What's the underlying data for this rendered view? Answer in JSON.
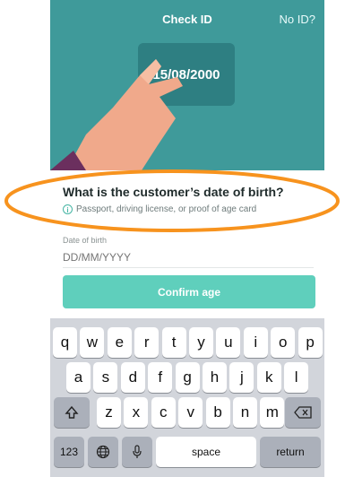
{
  "header": {
    "title": "Check ID",
    "no_id_link": "No ID?"
  },
  "card": {
    "date": "15/08/2000"
  },
  "form": {
    "question": "What is the customer’s date of birth?",
    "hint": "Passport, driving license, or proof of age card",
    "dob_label": "Date of birth",
    "dob_placeholder": "DD/MM/YYYY",
    "dob_value": "",
    "confirm_label": "Confirm age"
  },
  "keyboard": {
    "row1": [
      "q",
      "w",
      "e",
      "r",
      "t",
      "y",
      "u",
      "i",
      "o",
      "p"
    ],
    "row2": [
      "a",
      "s",
      "d",
      "f",
      "g",
      "h",
      "j",
      "k",
      "l"
    ],
    "row3": [
      "z",
      "x",
      "c",
      "v",
      "b",
      "n",
      "m"
    ],
    "numbers_key": "123",
    "space_key": "space",
    "return_key": "return"
  },
  "colors": {
    "header_bg": "#3f9a9a",
    "card_bg": "#2e7f82",
    "confirm_bg": "#5fcfbc",
    "highlight_oval": "#f7931e",
    "keyboard_bg": "#d2d5db"
  },
  "icons": [
    "info-icon",
    "shift-icon",
    "backspace-icon",
    "globe-icon",
    "microphone-icon"
  ]
}
